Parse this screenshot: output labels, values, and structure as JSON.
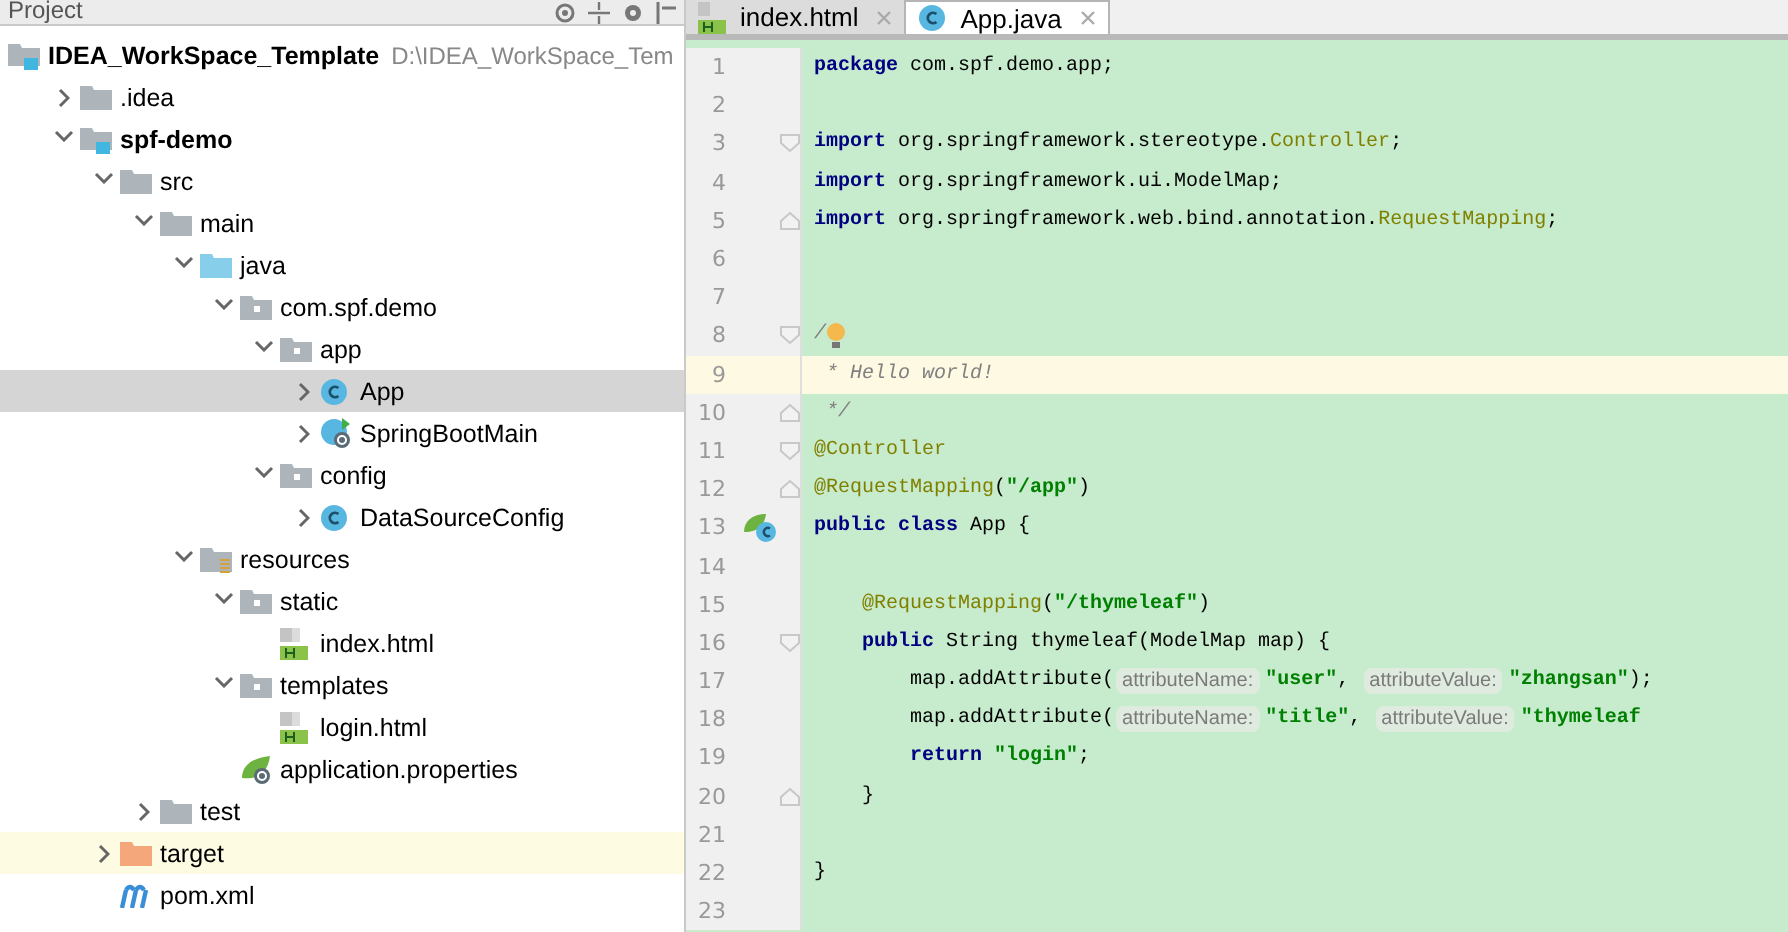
{
  "project_panel": {
    "title": "Project",
    "tree": [
      {
        "label": "IDEA_WorkSpace_Template",
        "path": "D:\\IDEA_WorkSpace_Tem",
        "kind": "module",
        "bold": true,
        "selected": false,
        "ignored": false,
        "children": [
          {
            "label": ".idea",
            "kind": "folder",
            "bold": false,
            "selected": false,
            "ignored": false,
            "expanded": false
          },
          {
            "label": "spf-demo",
            "kind": "module",
            "bold": true,
            "selected": false,
            "ignored": false,
            "expanded": true,
            "children": [
              {
                "label": "src",
                "kind": "folder",
                "bold": false,
                "selected": false,
                "ignored": false,
                "expanded": true,
                "children": [
                  {
                    "label": "main",
                    "kind": "folder",
                    "bold": false,
                    "selected": false,
                    "ignored": false,
                    "expanded": true,
                    "children": [
                      {
                        "label": "java",
                        "kind": "source",
                        "bold": false,
                        "selected": false,
                        "ignored": false,
                        "expanded": true,
                        "children": [
                          {
                            "label": "com.spf.demo",
                            "kind": "package",
                            "bold": false,
                            "selected": false,
                            "ignored": false,
                            "expanded": true,
                            "children": [
                              {
                                "label": "app",
                                "kind": "package",
                                "bold": false,
                                "selected": false,
                                "ignored": false,
                                "expanded": true,
                                "children": [
                                  {
                                    "label": "App",
                                    "kind": "class",
                                    "bold": false,
                                    "selected": true,
                                    "ignored": false,
                                    "expanded": false
                                  },
                                  {
                                    "label": "SpringBootMain",
                                    "kind": "springclass",
                                    "bold": false,
                                    "selected": false,
                                    "ignored": false,
                                    "expanded": false
                                  }
                                ]
                              },
                              {
                                "label": "config",
                                "kind": "package",
                                "bold": false,
                                "selected": false,
                                "ignored": false,
                                "expanded": true,
                                "children": [
                                  {
                                    "label": "DataSourceConfig",
                                    "kind": "class",
                                    "bold": false,
                                    "selected": false,
                                    "ignored": false,
                                    "expanded": false
                                  }
                                ]
                              }
                            ]
                          }
                        ]
                      },
                      {
                        "label": "resources",
                        "kind": "resources",
                        "bold": false,
                        "selected": false,
                        "ignored": false,
                        "expanded": true,
                        "children": [
                          {
                            "label": "static",
                            "kind": "package",
                            "bold": false,
                            "selected": false,
                            "ignored": false,
                            "expanded": true,
                            "children": [
                              {
                                "label": "index.html",
                                "kind": "html",
                                "bold": false,
                                "selected": false,
                                "ignored": false
                              }
                            ]
                          },
                          {
                            "label": "templates",
                            "kind": "package",
                            "bold": false,
                            "selected": false,
                            "ignored": false,
                            "expanded": true,
                            "children": [
                              {
                                "label": "login.html",
                                "kind": "html",
                                "bold": false,
                                "selected": false,
                                "ignored": false
                              }
                            ]
                          },
                          {
                            "label": "application.properties",
                            "kind": "springconfig",
                            "bold": false,
                            "selected": false,
                            "ignored": false
                          }
                        ]
                      }
                    ]
                  },
                  {
                    "label": "test",
                    "kind": "folder",
                    "bold": false,
                    "selected": false,
                    "ignored": false,
                    "expanded": false
                  }
                ]
              },
              {
                "label": "target",
                "kind": "excluded",
                "bold": false,
                "selected": false,
                "ignored": true,
                "expanded": false
              },
              {
                "label": "pom.xml",
                "kind": "maven",
                "bold": false,
                "selected": false,
                "ignored": false
              }
            ]
          }
        ]
      }
    ]
  },
  "editor": {
    "tabs": [
      {
        "label": "index.html",
        "kind": "html",
        "selected": false
      },
      {
        "label": "App.java",
        "kind": "class",
        "selected": true
      }
    ],
    "lines": [
      {
        "number": "1",
        "kind": "top",
        "current": false,
        "fold_start": false,
        "fold_end": false,
        "marker": false,
        "tokens": [
          {
            "kind": "keyword",
            "text": "package"
          },
          {
            "kind": "plain",
            "text": " com.spf.demo.app;"
          }
        ]
      },
      {
        "number": "2",
        "kind": "top",
        "current": false,
        "fold_start": false,
        "fold_end": false,
        "marker": false
      },
      {
        "number": "3",
        "kind": "top",
        "current": false,
        "fold_start": true,
        "fold_end": false,
        "marker": false,
        "tokens": [
          {
            "kind": "keyword",
            "text": "import"
          },
          {
            "kind": "plain",
            "text": " org.springframework.stereotype."
          },
          {
            "kind": "annotation",
            "text": "Controller"
          },
          {
            "kind": "plain",
            "text": ";"
          }
        ]
      },
      {
        "number": "4",
        "kind": "top",
        "current": false,
        "fold_start": false,
        "fold_end": false,
        "marker": false,
        "tokens": [
          {
            "kind": "keyword",
            "text": "import"
          },
          {
            "kind": "plain",
            "text": " org.springframework.ui.ModelMap;"
          }
        ]
      },
      {
        "number": "5",
        "kind": "top",
        "current": false,
        "fold_start": false,
        "fold_end": true,
        "marker": false,
        "tokens": [
          {
            "kind": "keyword",
            "text": "import"
          },
          {
            "kind": "plain",
            "text": " org.springframework.web.bind.annotation."
          },
          {
            "kind": "annotation",
            "text": "RequestMapping"
          },
          {
            "kind": "plain",
            "text": ";"
          }
        ]
      },
      {
        "number": "6",
        "kind": "top",
        "current": false,
        "fold_start": false,
        "fold_end": false,
        "marker": false
      },
      {
        "number": "7",
        "kind": "top",
        "current": false,
        "fold_start": false,
        "fold_end": false,
        "marker": false
      },
      {
        "number": "8",
        "kind": "top",
        "current": false,
        "fold_start": true,
        "fold_end": false,
        "marker": false,
        "tokens": [
          {
            "kind": "comment",
            "text": "/"
          },
          {
            "kind": "bulb"
          }
        ]
      },
      {
        "number": "9",
        "kind": "top",
        "current": true,
        "fold_start": false,
        "fold_end": false,
        "marker": false,
        "tokens": [
          {
            "kind": "comment",
            "text": " * Hello world!"
          }
        ]
      },
      {
        "number": "10",
        "kind": "top",
        "current": false,
        "fold_start": false,
        "fold_end": true,
        "marker": false,
        "tokens": [
          {
            "kind": "comment",
            "text": " */"
          }
        ]
      },
      {
        "number": "11",
        "kind": "top",
        "current": false,
        "fold_start": true,
        "fold_end": false,
        "marker": false,
        "tokens": [
          {
            "kind": "annotation",
            "text": "@Controller"
          }
        ]
      },
      {
        "number": "12",
        "kind": "top",
        "current": false,
        "fold_start": false,
        "fold_end": true,
        "marker": false,
        "tokens": [
          {
            "kind": "annotation",
            "text": "@RequestMapping"
          },
          {
            "kind": "plain",
            "text": "("
          },
          {
            "kind": "string",
            "text": "\"/app\""
          },
          {
            "kind": "plain",
            "text": ")"
          }
        ]
      },
      {
        "number": "13",
        "kind": "top",
        "current": false,
        "fold_start": false,
        "fold_end": false,
        "marker": true,
        "tokens": [
          {
            "kind": "keyword",
            "text": "public class"
          },
          {
            "kind": "plain",
            "text": " App {"
          }
        ]
      },
      {
        "number": "14",
        "kind": "top",
        "current": false,
        "fold_start": false,
        "fold_end": false,
        "marker": false
      },
      {
        "number": "15",
        "kind": "member",
        "current": false,
        "fold_start": false,
        "fold_end": false,
        "marker": false,
        "tokens": [
          {
            "kind": "annotation",
            "text": "@RequestMapping"
          },
          {
            "kind": "plain",
            "text": "("
          },
          {
            "kind": "string",
            "text": "\"/thymeleaf\""
          },
          {
            "kind": "plain",
            "text": ")"
          }
        ]
      },
      {
        "number": "16",
        "kind": "member",
        "current": false,
        "fold_start": true,
        "fold_end": false,
        "marker": false,
        "tokens": [
          {
            "kind": "keyword",
            "text": "public"
          },
          {
            "kind": "plain",
            "text": " String thymeleaf(ModelMap map) {"
          }
        ]
      },
      {
        "number": "17",
        "kind": "statement",
        "current": false,
        "fold_start": false,
        "fold_end": false,
        "marker": false,
        "tokens": [
          {
            "kind": "plain",
            "text": "map.addAttribute("
          },
          {
            "kind": "hint",
            "text": "attributeName:"
          },
          {
            "kind": "string",
            "text": "\"user\""
          },
          {
            "kind": "plain",
            "text": ", "
          },
          {
            "kind": "hint",
            "text": "attributeValue:"
          },
          {
            "kind": "string",
            "text": "\"zhangsan\""
          },
          {
            "kind": "plain",
            "text": ");"
          }
        ]
      },
      {
        "number": "18",
        "kind": "statement",
        "current": false,
        "fold_start": false,
        "fold_end": false,
        "marker": false,
        "tokens": [
          {
            "kind": "plain",
            "text": "map.addAttribute("
          },
          {
            "kind": "hint",
            "text": "attributeName:"
          },
          {
            "kind": "string",
            "text": "\"title\""
          },
          {
            "kind": "plain",
            "text": ", "
          },
          {
            "kind": "hint",
            "text": "attributeValue:"
          },
          {
            "kind": "string",
            "text": "\"thymeleaf"
          }
        ]
      },
      {
        "number": "19",
        "kind": "statement",
        "current": false,
        "fold_start": false,
        "fold_end": false,
        "marker": false,
        "tokens": [
          {
            "kind": "keyword",
            "text": "return"
          },
          {
            "kind": "string",
            "text": " \"login\""
          },
          {
            "kind": "plain",
            "text": ";"
          }
        ]
      },
      {
        "number": "20",
        "kind": "member",
        "current": false,
        "fold_start": false,
        "fold_end": true,
        "marker": false,
        "tokens": [
          {
            "kind": "plain",
            "text": "}"
          }
        ]
      },
      {
        "number": "21",
        "kind": "top",
        "current": false,
        "fold_start": false,
        "fold_end": false,
        "marker": false
      },
      {
        "number": "22",
        "kind": "top",
        "current": false,
        "fold_start": false,
        "fold_end": false,
        "marker": false,
        "tokens": [
          {
            "kind": "plain",
            "text": "}"
          }
        ]
      },
      {
        "number": "23",
        "kind": "top",
        "current": false,
        "fold_start": false,
        "fold_end": false,
        "marker": false
      }
    ]
  }
}
